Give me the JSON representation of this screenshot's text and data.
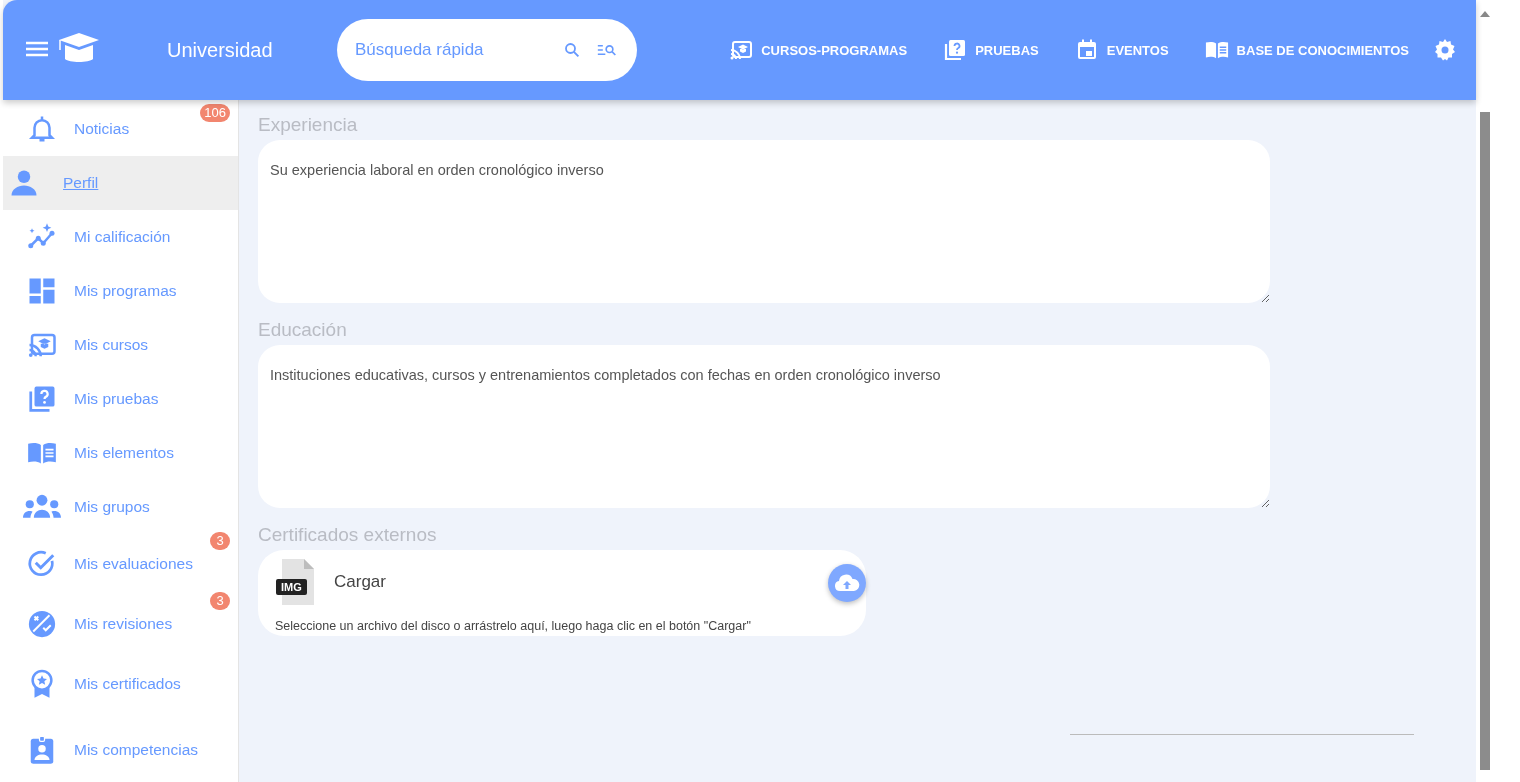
{
  "header": {
    "title": "Universidad",
    "search": {
      "placeholder": "Búsqueda rápida"
    },
    "nav": [
      {
        "label": "CURSOS-PROGRAMAS",
        "kind": "courses"
      },
      {
        "label": "PRUEBAS",
        "kind": "tests"
      },
      {
        "label": "EVENTOS",
        "kind": "events"
      },
      {
        "label": "BASE DE CONOCIMIENTOS",
        "kind": "knowledge"
      }
    ]
  },
  "sidebar": {
    "items": [
      {
        "label": "Noticias",
        "kind": "bell",
        "badge": "106",
        "selected": false
      },
      {
        "label": "Perfil",
        "kind": "person",
        "selected": true
      },
      {
        "label": "Mi calificación",
        "kind": "rating",
        "selected": false
      },
      {
        "label": "Mis programas",
        "kind": "dashboard",
        "selected": false
      },
      {
        "label": "Mis cursos",
        "kind": "courses",
        "selected": false
      },
      {
        "label": "Mis pruebas",
        "kind": "tests",
        "selected": false
      },
      {
        "label": "Mis elementos",
        "kind": "knowledge",
        "selected": false
      },
      {
        "label": "Mis grupos",
        "kind": "groups",
        "selected": false
      },
      {
        "label": "Mis evaluaciones",
        "kind": "check",
        "badge": "3",
        "selected": false
      },
      {
        "label": "Mis revisiones",
        "kind": "review",
        "badge": "3",
        "selected": false
      },
      {
        "label": "Mis certificados",
        "kind": "award",
        "selected": false
      },
      {
        "label": "Mis competencias",
        "kind": "badge",
        "selected": false
      }
    ]
  },
  "form": {
    "sections": [
      {
        "label": "Experiencia",
        "kind": "textarea",
        "placeholder": "Su experiencia laboral en orden cronológico inverso"
      },
      {
        "label": "Educación",
        "kind": "textarea",
        "placeholder": "Instituciones educativas, cursos y entrenamientos completados con fechas en orden cronológico inverso"
      },
      {
        "label": "Certificados externos",
        "kind": "upload",
        "file_type": "IMG",
        "button": "Cargar",
        "hint": "Seleccione un archivo del disco o arrástrelo aquí, luego haga clic en el botón \"Cargar\""
      }
    ]
  }
}
